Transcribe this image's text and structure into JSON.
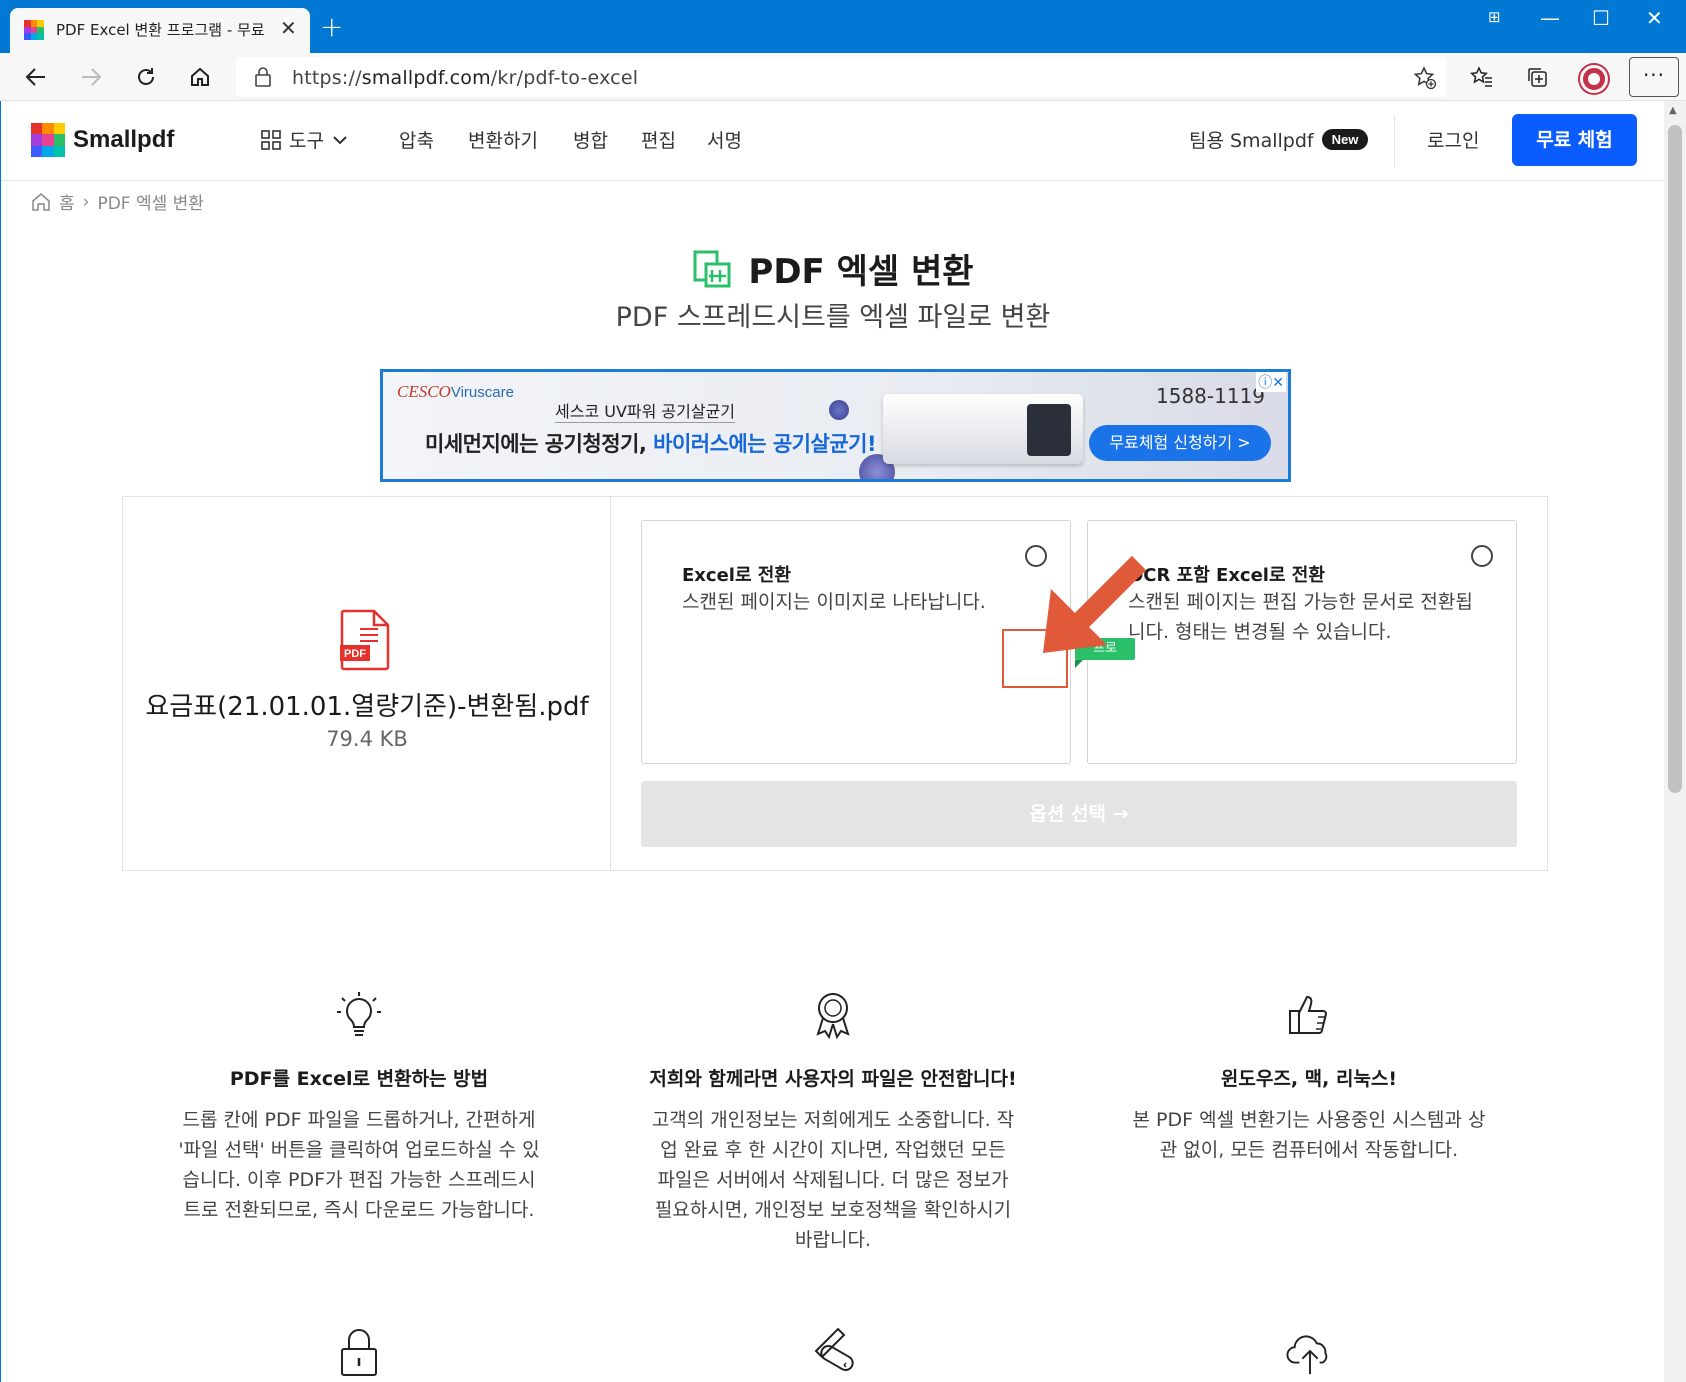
{
  "browser": {
    "tab_title": "PDF Excel 변환 프로그램 - 무료",
    "url_prefix": "https://",
    "url_domain": "smallpdf.com",
    "url_path": "/kr/pdf-to-excel"
  },
  "nav": {
    "logo": "Smallpdf",
    "tools": "도구",
    "links": [
      "압축",
      "변환하기",
      "병합",
      "편집",
      "서명"
    ],
    "team": "팀용 Smallpdf",
    "new_badge": "New",
    "login": "로그인",
    "trial": "무료 체험"
  },
  "breadcrumb": {
    "home": "홈",
    "current": "PDF 엑셀 변환"
  },
  "hero": {
    "title": "PDF 엑셀 변환",
    "subtitle": "PDF 스프레드시트를 엑셀 파일로 변환"
  },
  "ad": {
    "brand": "CESCO",
    "brand_sub": "Viruscare",
    "tagline": "세스코 UV파워 공기살균기",
    "headline_a": "미세먼지에는 공기청정기, ",
    "headline_b": "바이러스에는 공기살균기!",
    "phone": "1588-1119",
    "cta": "무료체험 신청하기 >"
  },
  "file": {
    "name": "요금표(21.01.01.열량기준)-변환됨.pdf",
    "size": "79.4 KB",
    "icon_label": "PDF"
  },
  "options": [
    {
      "title": "Excel로 전환",
      "desc": "스캔된 페이지는 이미지로 나타납니다."
    },
    {
      "title": "OCR 포함 Excel로 전환",
      "desc": "스캔된 페이지는 편집 가능한 문서로 전환됩니다. 형태는 변경될 수 있습니다."
    }
  ],
  "pro_badge": "프로",
  "choose_button": "옵션 선택",
  "features": [
    {
      "icon": "lightbulb-icon",
      "title": "PDF를 Excel로 변환하는 방법",
      "desc": "드롭 칸에 PDF 파일을 드롭하거나, 간편하게 '파일 선택' 버튼을 클릭하여 업로드하실 수 있습니다. 이후 PDF가 편집 가능한 스프레드시트로 전환되므로, 즉시 다운로드 가능합니다."
    },
    {
      "icon": "award-icon",
      "title": "저희와 함께라면 사용자의 파일은 안전합니다!",
      "desc": "고객의 개인정보는 저희에게도 소중합니다. 작업 완료 후 한 시간이 지나면, 작업했던 모든 파일은 서버에서 삭제됩니다. 더 많은 정보가 필요하시면, 개인정보 보호정책을 확인하시기 바랍니다."
    },
    {
      "icon": "thumbs-up-icon",
      "title": "윈도우즈, 맥, 리눅스!",
      "desc": "본 PDF 엑셀 변환기는 사용중인 시스템과 상관 없이, 모든 컴퓨터에서 작동합니다."
    }
  ],
  "colors": {
    "brand_blue": "#0b5cff",
    "edge_blue": "#0078d4",
    "excel_green": "#2bbf6a",
    "pdf_red": "#e5322d",
    "annotation_orange": "#e05a3a"
  }
}
